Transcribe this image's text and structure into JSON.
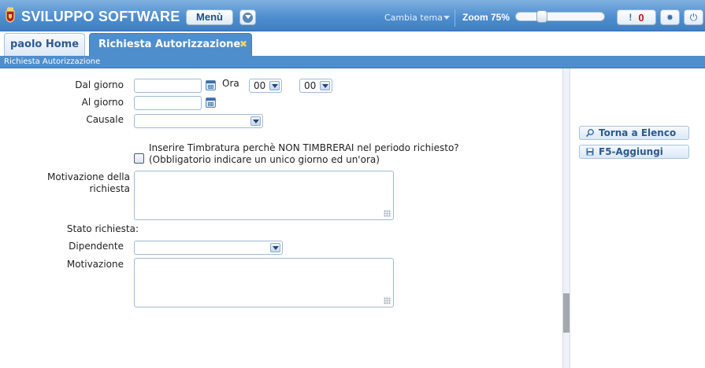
{
  "header": {
    "brand": "SVILUPPO SOFTWARE",
    "menu_label": "Menù",
    "theme_label": "Cambia tema",
    "zoom_label": "Zoom 75%",
    "zoom_level": 0.27,
    "notification_glyph": "!",
    "notification_count": "0",
    "icons": [
      "crest-logo-icon",
      "chevron-down-icon",
      "gear-icon",
      "power-icon"
    ]
  },
  "tabs": [
    {
      "label": "paolo Home",
      "active": false
    },
    {
      "label": "Richiesta Autorizzazione",
      "active": true,
      "close": "✖"
    }
  ],
  "breadcrumb": "Richiesta Autorizzazione",
  "form": {
    "dal_giorno_label": "Dal giorno",
    "ora_label": "Ora",
    "hour_value": "00",
    "minute_value": "00",
    "al_giorno_label": "Al giorno",
    "causale_label": "Causale",
    "causale_value": "",
    "timbratura_line1": "Inserire Timbratura perchè NON TIMBRERAI nel periodo richiesto?",
    "timbratura_line2": "(Obbligatorio indicare un unico giorno ed un'ora)",
    "timbratura_checked": false,
    "motivazione_richiesta_label": "Motivazione della richiesta",
    "motivazione_richiesta_value": "",
    "stato_label": "Stato richiesta:",
    "dipendente_label": "Dipendente",
    "dipendente_value": "",
    "motivazione_label": "Motivazione",
    "motivazione_value": ""
  },
  "actions": {
    "back_label": "Torna a Elenco",
    "add_label": "F5-Aggiungi"
  },
  "colors": {
    "header_blue": "#4f8fcf",
    "tab_active": "#4f8ecc",
    "notification_red": "#c31515",
    "field_border": "#9fbad6"
  }
}
